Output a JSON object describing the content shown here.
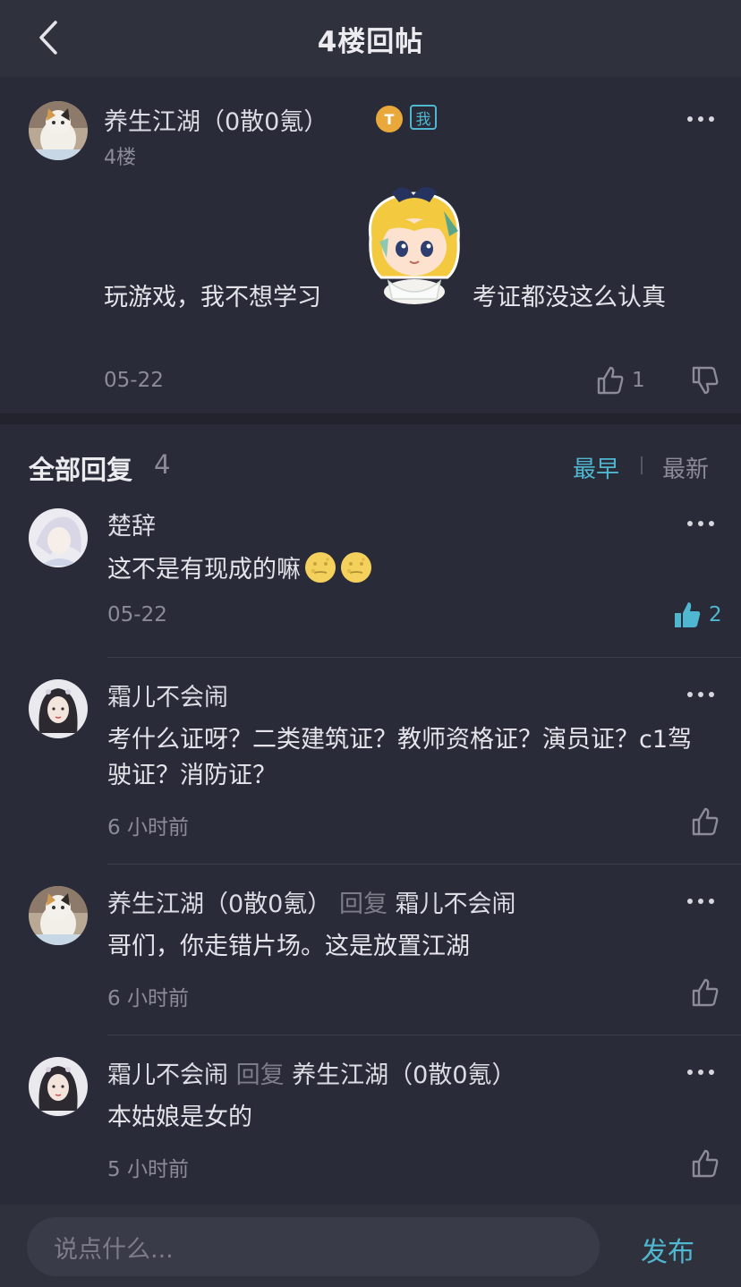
{
  "nav": {
    "title": "4楼回帖"
  },
  "post": {
    "author": "养生江湖（0散0氪）",
    "badge_t": "T",
    "badge_me": "我",
    "floor": "4楼",
    "text_before": "玩游戏，我不想学习",
    "text_after": "考证都没这么认真",
    "date": "05-22",
    "likes": "1"
  },
  "replies_header": {
    "label": "全部回复",
    "count": "4",
    "sort_earliest": "最早",
    "sort_newest": "最新",
    "active_sort": "最早"
  },
  "replies": [
    {
      "author": "楚辞",
      "text": "这不是有现成的嘛",
      "emoji": [
        "moon-face-icon",
        "moon-face-icon"
      ],
      "date": "05-22",
      "likes": "2",
      "liked": true
    },
    {
      "author": "霜儿不会闹",
      "text": "考什么证呀？二类建筑证？教师资格证？演员证？c1驾驶证？消防证？",
      "date": "6 小时前"
    },
    {
      "author": "养生江湖（0散0氪）",
      "reply_word": "回复",
      "reply_to": "霜儿不会闹",
      "text": "哥们，你走错片场。这是放置江湖",
      "date": "6 小时前"
    },
    {
      "author": "霜儿不会闹",
      "reply_word": "回复",
      "reply_to": "养生江湖（0散0氪）",
      "text": "本姑娘是女的",
      "date": "5 小时前"
    }
  ],
  "composer": {
    "placeholder": "说点什么...",
    "publish_label": "发布"
  },
  "colors": {
    "background": "#2a2b38",
    "accent": "#4fb8d0",
    "muted": "#8b8c98"
  }
}
